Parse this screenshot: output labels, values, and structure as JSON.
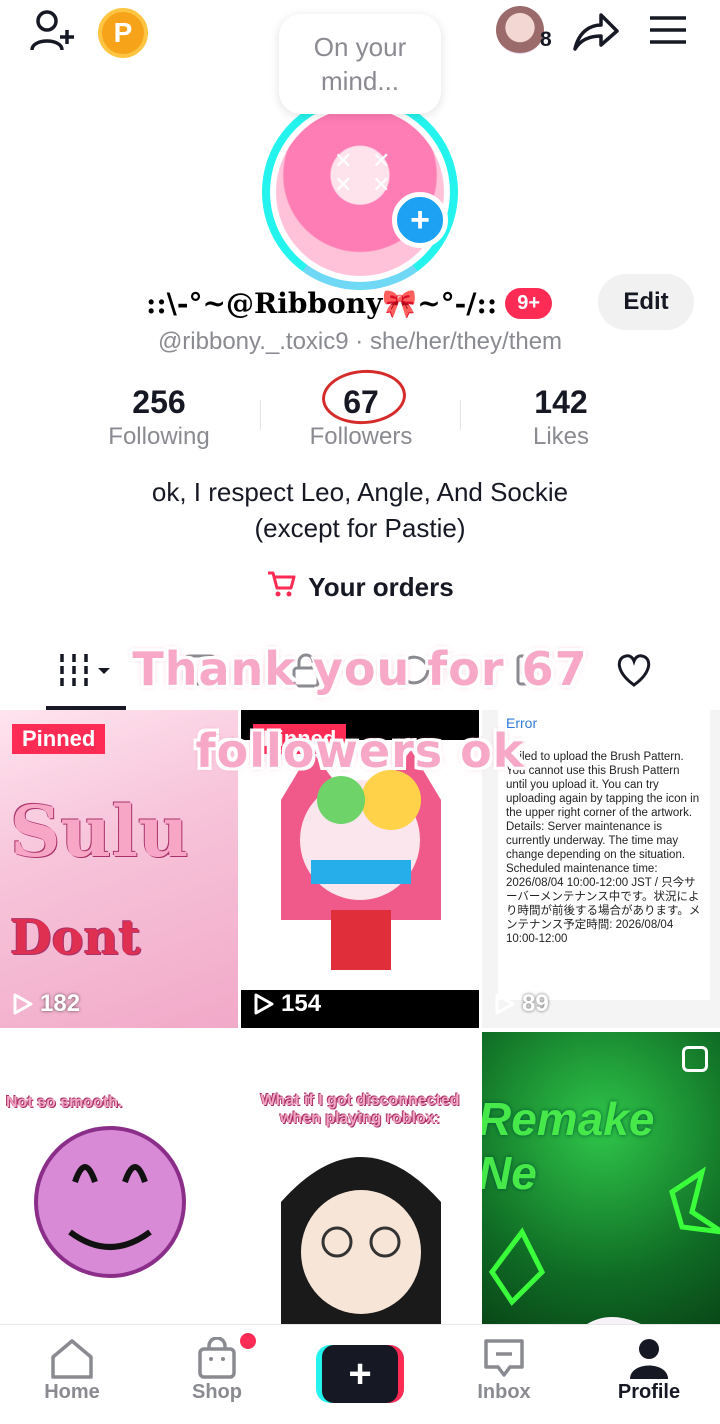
{
  "header": {
    "coin_label": "P",
    "follower_requests_count": "8",
    "icons": [
      "add-user-icon",
      "coin-icon",
      "share-icon",
      "menu-icon"
    ]
  },
  "profile": {
    "status_bubble": "On your mind...",
    "display_name": "::\\-°~@Ribbony🎀~°-/::",
    "badge": "9+",
    "edit_label": "Edit",
    "handle": "@ribbony._.toxic9 · she/her/they/them",
    "stats": {
      "following": {
        "value": "256",
        "label": "Following"
      },
      "followers": {
        "value": "67",
        "label": "Followers"
      },
      "likes": {
        "value": "142",
        "label": "Likes"
      }
    },
    "bio_line1": "ok, I respect Leo, Angle, And Sockie",
    "bio_line2": "(except for Pastie)",
    "orders_label": "Your orders"
  },
  "overlay": {
    "line1": "Thank you for 67",
    "line2": "followers ok"
  },
  "videos": [
    {
      "views": "182",
      "pinned": "Pinned"
    },
    {
      "views": "154",
      "pinned": "Pinned"
    },
    {
      "views": "89",
      "error_title": "Error",
      "error_body": "Failed to upload the Brush Pattern. You cannot use this Brush Pattern until you upload it. You can try uploading again by tapping the icon in the upper right corner of the artwork. Details: Server maintenance is currently underway. The time may change depending on the situation. Scheduled maintenance time: 2026/08/04 10:00-12:00 JST / 只今サーバーメンテナンス中です。状況により時間が前後する場合があります。メンテナンス予定時間: 2026/08/04 10:00-12:00"
    },
    {
      "caption": "Not so smooth."
    },
    {
      "caption": "What if I got disconnected when playing roblox:"
    },
    {
      "caption": "Remake Ne"
    }
  ],
  "nav": {
    "home": "Home",
    "shop": "Shop",
    "inbox": "Inbox",
    "profile": "Profile"
  },
  "colors": {
    "accent": "#fe2c55",
    "cyan": "#25f4ee",
    "text": "#161823",
    "muted": "#8a8b91"
  }
}
